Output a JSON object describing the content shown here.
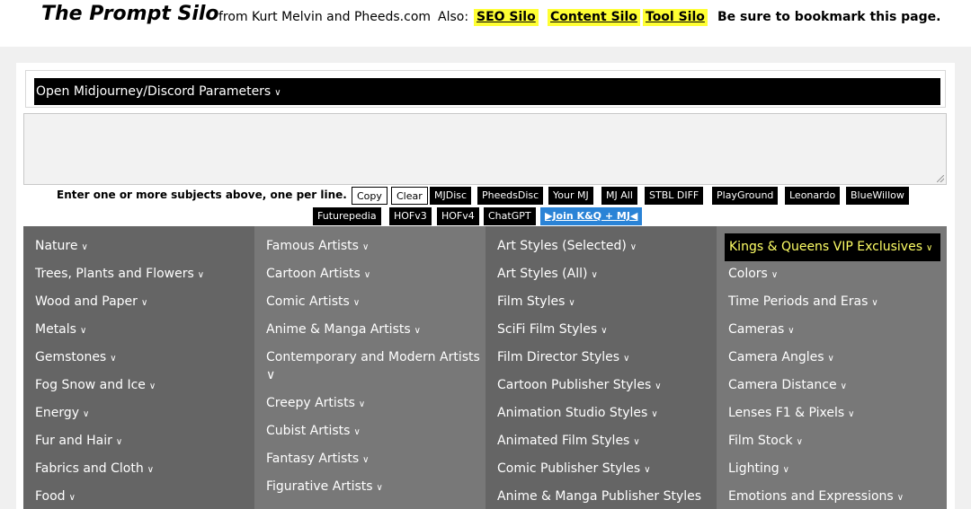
{
  "header": {
    "title": "The Prompt Silo",
    "byline": "from Kurt Melvin and Pheeds.com",
    "also": "Also:",
    "links": [
      "SEO Silo",
      "Content Silo",
      "Tool Silo"
    ],
    "bookmark": "Be sure to bookmark this page.",
    "link_color": "#ffff33"
  },
  "params": {
    "label": "Open Midjourney/Discord Parameters",
    "chevron": "∨"
  },
  "subjects": {
    "placeholder": "",
    "instructions": "Enter one or more subjects above, one per line."
  },
  "toolbar": {
    "row1": [
      "Copy",
      "Clear",
      "MJDisc",
      "PheedsDisc",
      "Your MJ",
      "MJ All",
      "STBL DIFF",
      "PlayGround",
      "Leonardo",
      "BlueWillow"
    ],
    "row2": [
      "Futurepedia",
      "HOFv3",
      "HOFv4",
      "ChatGPT",
      "▶Join K&Q + MJ◀"
    ]
  },
  "columns": [
    {
      "items": [
        "Nature",
        "Trees, Plants and Flowers",
        "Wood and Paper",
        "Metals",
        "Gemstones",
        "Fog Snow and Ice",
        "Energy",
        "Fur and Hair",
        "Fabrics and Cloth",
        "Food"
      ]
    },
    {
      "items": [
        "Famous Artists",
        "Cartoon Artists",
        "Comic Artists",
        "Anime & Manga Artists",
        "Contemporary and Modern Artists",
        "Creepy Artists",
        "Cubist Artists",
        "Fantasy Artists",
        "Figurative Artists"
      ]
    },
    {
      "items": [
        "Art Styles (Selected)",
        "Art Styles (All)",
        "Film Styles",
        "SciFi Film Styles",
        "Film Director Styles",
        "Cartoon Publisher Styles",
        "Animation Studio Styles",
        "Animated Film Styles",
        "Comic Publisher Styles",
        "Anime & Manga Publisher Styles"
      ]
    },
    {
      "vip": "Kings & Queens VIP Exclusives",
      "items": [
        "Colors",
        "Time Periods and Eras",
        "Cameras",
        "Camera Angles",
        "Camera Distance",
        "Lenses F1 & Pixels",
        "Film Stock",
        "Lighting",
        "Emotions and Expressions"
      ]
    }
  ],
  "colors": {
    "col_dark": "#656565",
    "col_light": "#787878",
    "vip_text": "#ffff66",
    "join_button": "#2a83d6"
  },
  "icons": {
    "chevron": "chevron-down-icon",
    "resize": "resize-grip-icon"
  }
}
